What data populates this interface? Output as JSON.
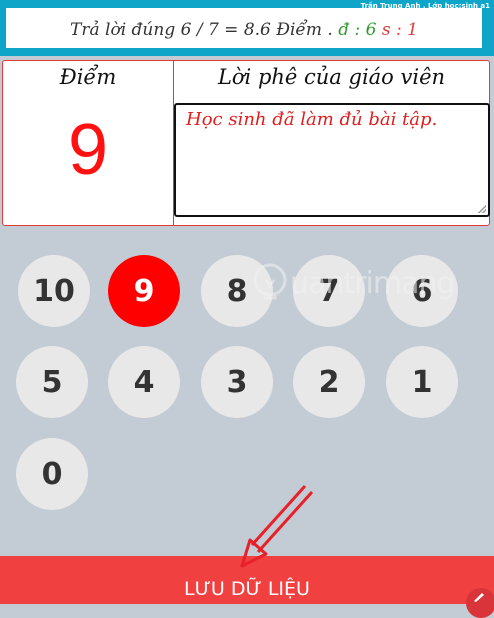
{
  "header": {
    "user_info": "Trần Trung Anh , Lớp học:sinh a1",
    "result_prefix": "Trả lời đúng 6 / 7 = 8.6 Điểm .",
    "d_label": "đ : 6",
    "s_label": "s : 1"
  },
  "grading": {
    "score_heading": "Điểm",
    "score_value": "9",
    "comment_heading": "Lời phê của giáo viên",
    "comment_text": "Học sinh đã làm đủ bài tập."
  },
  "keypad": {
    "selected": "9",
    "buttons": [
      "10",
      "9",
      "8",
      "7",
      "6",
      "5",
      "4",
      "3",
      "2",
      "1",
      "0"
    ]
  },
  "save_button": {
    "label": "LƯU DỮ LIỆU"
  },
  "watermark": {
    "text": "uantrimang"
  },
  "colors": {
    "accent_red": "#f04040",
    "selected_key": "#ff0000",
    "topbar": "#0fa5c9",
    "panel_bg": "#c3ccd4"
  }
}
